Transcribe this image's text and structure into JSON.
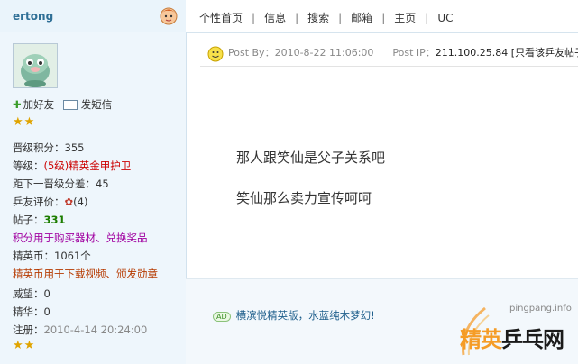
{
  "header": {
    "username": "ertong",
    "menu": [
      "个性首页",
      "信息",
      "搜索",
      "邮箱",
      "主页",
      "UC"
    ],
    "menu_separator": "|"
  },
  "profile": {
    "actions": {
      "add_friend": "加好友",
      "send_message": "发短信"
    },
    "rows": {
      "level_points_label": "晋级积分：",
      "level_points": "355",
      "rank_label": "等级：",
      "rank": "(5级)精英金甲护卫",
      "next_level_label": "距下一晋级分差：",
      "next_level": "45",
      "rating_label": "乒友评价：",
      "rating": "(4)",
      "posts_label": "帖子：",
      "posts": "331",
      "points_note": "积分用于购买器材、兑换奖品",
      "coins_label": "精英币：",
      "coins": "1061个",
      "coins_note": "精英币用于下载视频、颁发勋章",
      "prestige_label": "威望：",
      "prestige": "0",
      "essence_label": "精华：",
      "essence": "0",
      "registered_label": "注册：",
      "registered": "2010-4-14 20:24:00"
    }
  },
  "post": {
    "post_by_label": "Post By：",
    "post_by": "2010-8-22 11:06:00",
    "post_ip_label": "Post IP：",
    "post_ip": "211.100.25.84",
    "view_only": "[只看该乒友帖子]",
    "lines": [
      "那人跟笑仙是父子关系吧",
      "笑仙那么卖力宣传呵呵"
    ]
  },
  "ad": {
    "tag": "AD",
    "text": "横滨悦精英版，水蓝纯木梦幻!"
  },
  "watermark": {
    "url": "pingpang.info",
    "text_orange": "精英",
    "text_black": "乒乓网"
  },
  "colors": {
    "accent": "#2f6f96",
    "star": "#e0a400",
    "brand_orange": "#f59c26"
  }
}
